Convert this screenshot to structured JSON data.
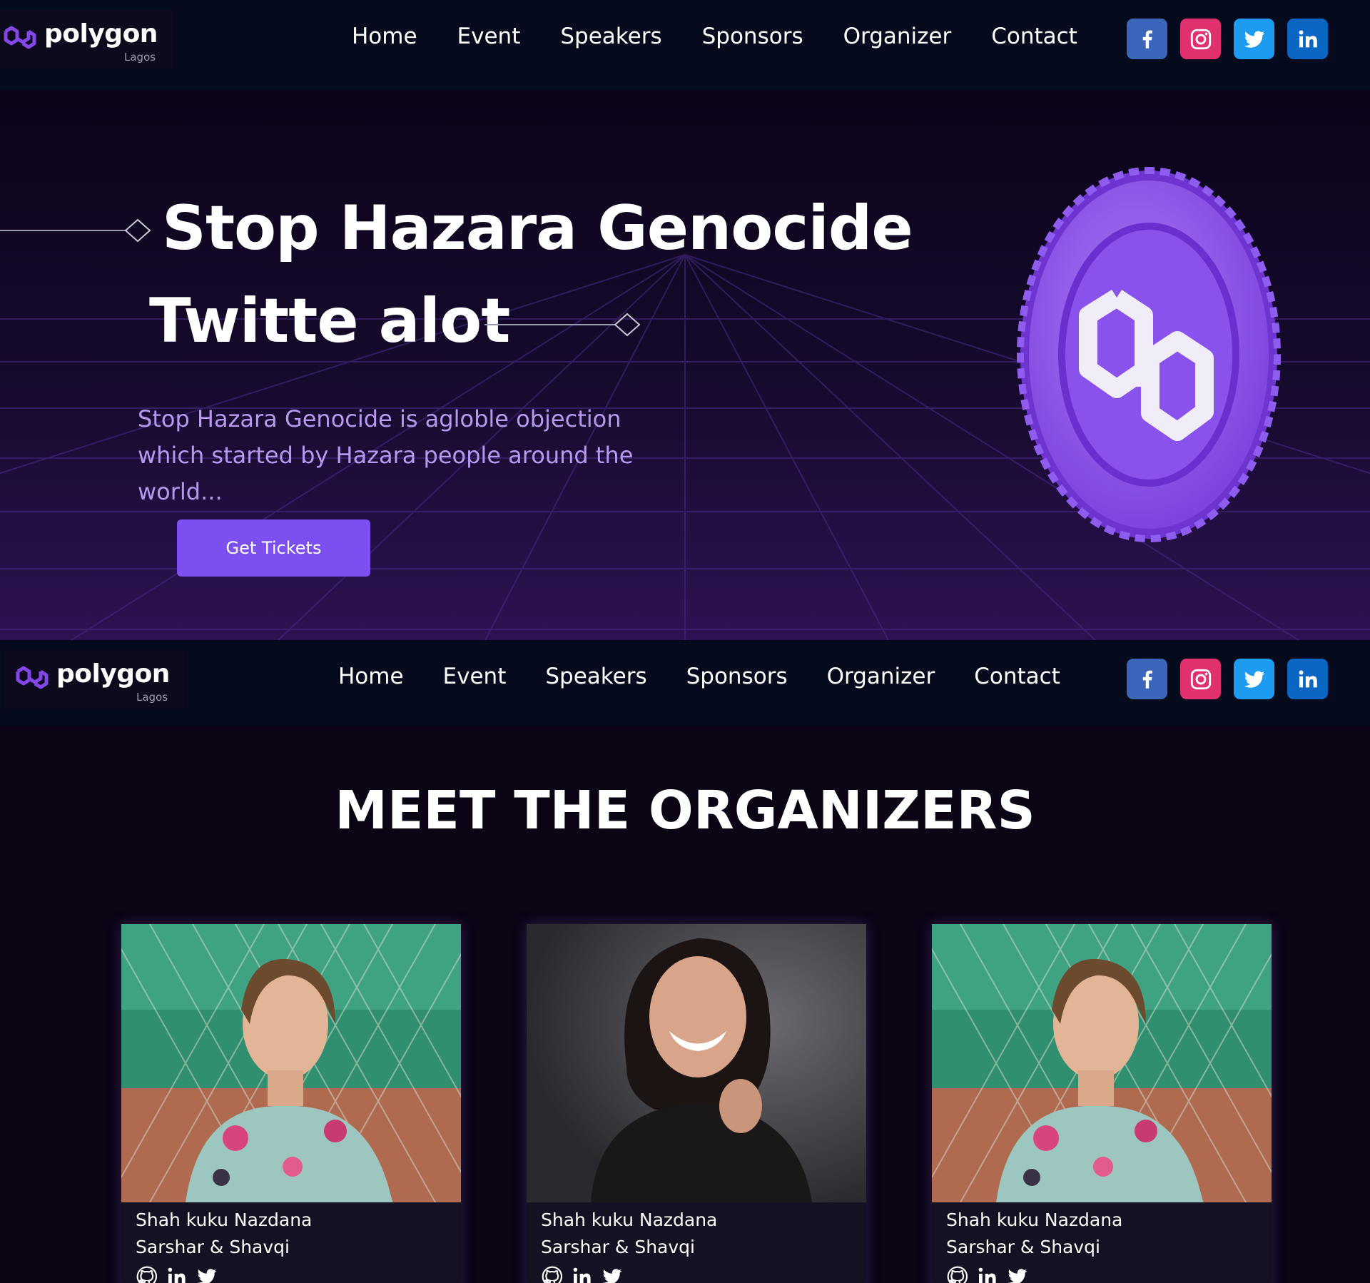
{
  "brand": {
    "name": "polygon",
    "sub": "Lagos"
  },
  "nav": {
    "links": [
      "Home",
      "Event",
      "Speakers",
      "Sponsors",
      "Organizer",
      "Contact"
    ],
    "socials": [
      {
        "name": "facebook-icon",
        "color": "#3b65b8"
      },
      {
        "name": "instagram-icon",
        "color": "#e0306e"
      },
      {
        "name": "twitter-icon",
        "color": "#1d9bf0"
      },
      {
        "name": "linkedin-icon",
        "color": "#0a66c2"
      }
    ]
  },
  "hero": {
    "title_line1": "Stop Hazara Genocide",
    "title_line2": "Twitte alot",
    "description_line1": "Stop Hazara Genocide is agloble objection",
    "description_line2": "which started by Hazara people around the world...",
    "cta": "Get Tickets",
    "accent": "#7b4ff0"
  },
  "organizers": {
    "title": "MEET THE ORGANIZERS",
    "cards": [
      {
        "name": "Shah kuku Nazdana",
        "role": "Sarshar & Shavqi",
        "photo": "woman-outdoor-fence"
      },
      {
        "name": "Shah kuku Nazdana",
        "role": "Sarshar & Shavqi",
        "photo": "woman-laughing-dark"
      },
      {
        "name": "Shah kuku Nazdana",
        "role": "Sarshar & Shavqi",
        "photo": "woman-outdoor-fence"
      }
    ],
    "card_icons": [
      "github-icon",
      "linkedin-icon",
      "twitter-icon"
    ]
  }
}
